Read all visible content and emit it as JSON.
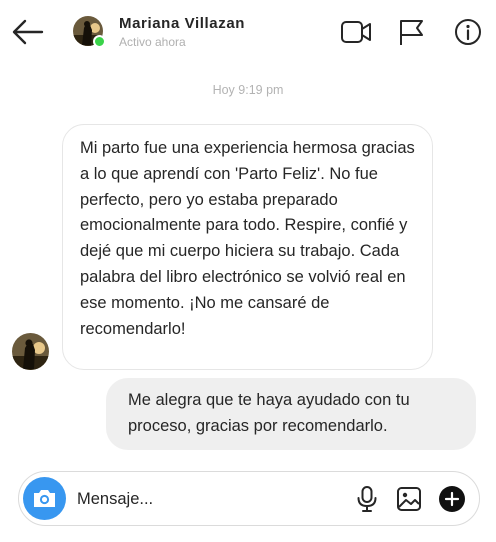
{
  "header": {
    "contact_name": "Mariana  Villazan",
    "status": "Activo ahora",
    "icons": [
      "back-arrow-icon",
      "video-call-icon",
      "report-flag-icon",
      "info-icon"
    ],
    "online_color": "#3ad34a"
  },
  "thread": {
    "timestamp": "Hoy 9:19 pm",
    "messages": [
      {
        "direction": "incoming",
        "text": " Mi parto fue una experiencia hermosa gracias a lo que aprendí con 'Parto Feliz'. No fue perfecto, pero yo estaba preparado emocionalmente para todo. Respire, confié y dejé que mi cuerpo hiciera su trabajo. Cada palabra del libro electrónico se volvió real en ese momento. ¡No me cansaré de recomendarlo!"
      },
      {
        "direction": "outgoing",
        "text": "Me alegra que te haya ayudado con tu proceso, gracias por recomendarlo."
      }
    ]
  },
  "composer": {
    "placeholder": "Mensaje...",
    "icons": [
      "camera-icon",
      "microphone-icon",
      "image-icon",
      "add-icon"
    ],
    "accent_color": "#3897f0"
  }
}
